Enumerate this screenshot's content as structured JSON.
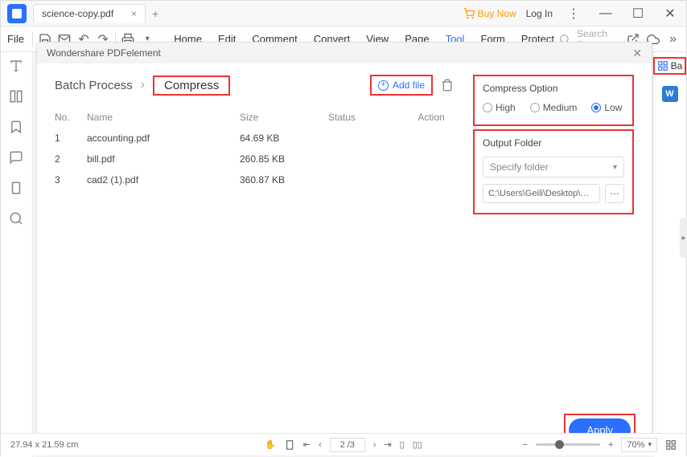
{
  "titlebar": {
    "filename": "science-copy.pdf",
    "buy_now": "Buy Now",
    "login": "Log In"
  },
  "toolbar": {
    "file": "File",
    "menu": [
      "Home",
      "Edit",
      "Comment",
      "Convert",
      "View",
      "Page",
      "Tool",
      "Form",
      "Protect"
    ],
    "active_menu": "Tool",
    "search_placeholder": "Search Tools"
  },
  "right_bar": {
    "ba": "Ba"
  },
  "modal": {
    "header": "Wondershare PDFelement",
    "batch_title": "Batch Process",
    "compress_tab": "Compress",
    "add_file": "Add file",
    "columns": {
      "no": "No.",
      "name": "Name",
      "size": "Size",
      "status": "Status",
      "action": "Action"
    },
    "rows": [
      {
        "no": "1",
        "name": "accounting.pdf",
        "size": "64.69 KB"
      },
      {
        "no": "2",
        "name": "bill.pdf",
        "size": "260.85 KB"
      },
      {
        "no": "3",
        "name": "cad2 (1).pdf",
        "size": "360.87 KB"
      }
    ],
    "compress_option": {
      "title": "Compress Option",
      "high": "High",
      "medium": "Medium",
      "low": "Low"
    },
    "output": {
      "title": "Output Folder",
      "specify": "Specify folder",
      "path": "C:\\Users\\Geili\\Desktop\\PDFelement\\Out"
    },
    "apply": "Apply"
  },
  "statusbar": {
    "dimensions": "27.94 x 21.59 cm",
    "page": "2 /3",
    "zoom": "70%"
  }
}
